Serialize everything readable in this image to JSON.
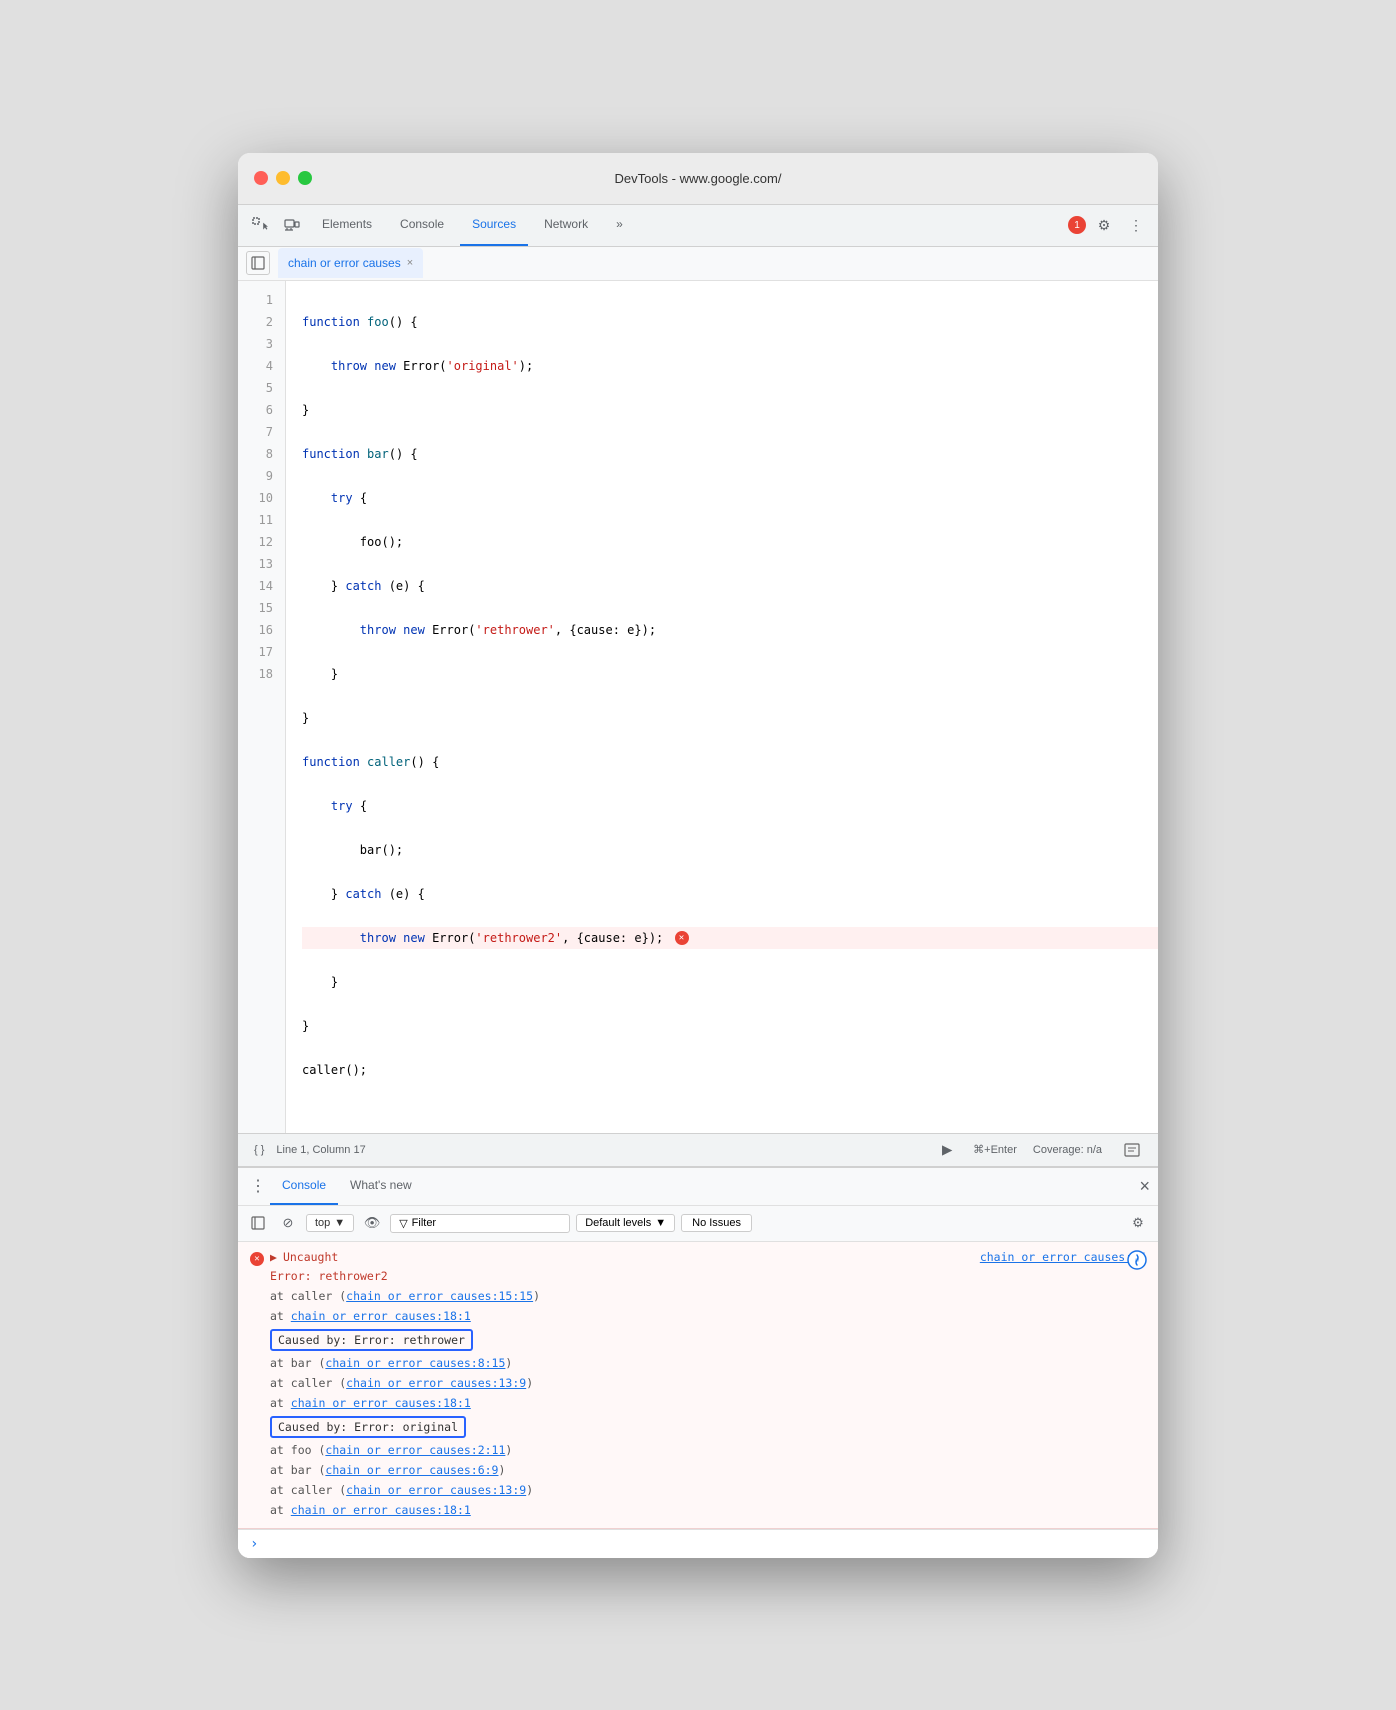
{
  "titlebar": {
    "title": "DevTools - www.google.com/"
  },
  "devtools_nav": {
    "tabs": [
      {
        "label": "Elements",
        "active": false
      },
      {
        "label": "Console",
        "active": false
      },
      {
        "label": "Sources",
        "active": true
      },
      {
        "label": "Network",
        "active": false
      },
      {
        "label": "»",
        "active": false
      }
    ],
    "badge": "1",
    "gear_label": "⚙",
    "more_label": "⋮"
  },
  "file_tab": {
    "name": "chain or error causes",
    "close": "×"
  },
  "code": {
    "lines": [
      {
        "num": "1",
        "content": "function foo() {"
      },
      {
        "num": "2",
        "content": "    throw new Error('original');"
      },
      {
        "num": "3",
        "content": "}"
      },
      {
        "num": "4",
        "content": "function bar() {"
      },
      {
        "num": "5",
        "content": "    try {"
      },
      {
        "num": "6",
        "content": "        foo();"
      },
      {
        "num": "7",
        "content": "    } catch (e) {"
      },
      {
        "num": "8",
        "content": "        throw new Error('rethrower', {cause: e});"
      },
      {
        "num": "9",
        "content": "    }"
      },
      {
        "num": "10",
        "content": "}"
      },
      {
        "num": "11",
        "content": "function caller() {"
      },
      {
        "num": "12",
        "content": "    try {"
      },
      {
        "num": "13",
        "content": "        bar();"
      },
      {
        "num": "14",
        "content": "    } catch (e) {"
      },
      {
        "num": "15",
        "content": "        throw new Error('rethrower2', {cause: e});",
        "error": true
      },
      {
        "num": "16",
        "content": "    }"
      },
      {
        "num": "17",
        "content": "}"
      },
      {
        "num": "18",
        "content": "caller();"
      }
    ]
  },
  "status_bar": {
    "position": "Line 1, Column 17",
    "run": "⌘+Enter",
    "coverage": "Coverage: n/a",
    "format_icon": "{ }"
  },
  "console": {
    "tab_console": "Console",
    "tab_whats_new": "What's new",
    "toolbar": {
      "top_label": "top",
      "filter_placeholder": "Filter",
      "levels_label": "Default levels",
      "no_issues": "No Issues"
    },
    "error": {
      "type": "Uncaught",
      "error_name": "Error: rethrower2",
      "source_link": "chain or error causes:15",
      "stack": [
        "    at caller (chain or error causes:15:15)",
        "    at chain or error causes:18:1"
      ],
      "caused_by_1": {
        "label": "Caused by: Error: rethrower",
        "stack": [
          "    at bar (chain or error causes:8:15)",
          "    at caller (chain or error causes:13:9)",
          "    at chain or error causes:18:1"
        ]
      },
      "caused_by_2": {
        "label": "Caused by: Error: original",
        "stack": [
          "    at foo (chain or error causes:2:11)",
          "    at bar (chain or error causes:6:9)",
          "    at caller (chain or error causes:13:9)",
          "    at chain or error causes:18:1"
        ]
      }
    }
  }
}
